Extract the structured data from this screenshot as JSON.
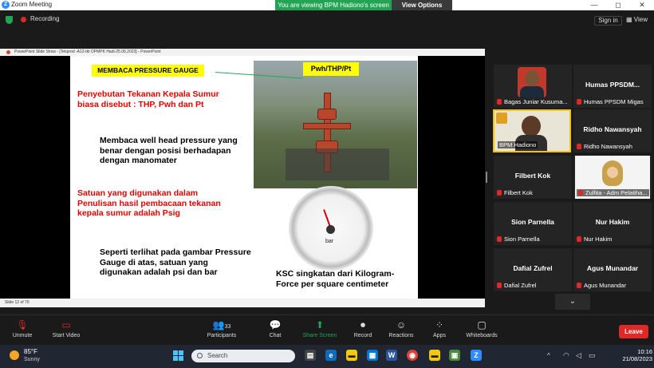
{
  "window": {
    "app_title": "Zoom Meeting",
    "viewing_banner": "You are viewing BPM Hadiono's screen",
    "view_options_label": "View Options",
    "controls": [
      "—",
      "◻",
      "✕"
    ]
  },
  "header": {
    "recording_label": "Recording",
    "sign_in_label": "Sign in",
    "view_label": "View"
  },
  "ppt": {
    "title_bar": "PowerPoint Slide Show - [Tekprod -A12-tkt OPMPK Hadi-25.06.2023] - PowerPoint",
    "status": "Slide 12 of 70"
  },
  "slide": {
    "title": "MEMBACA PRESSURE GAUGE",
    "photo_label": "Pwh/THP/Pt",
    "para1": "Penyebutan Tekanan Kepala Sumur biasa disebut : THP, Pwh dan Pt",
    "para2": "Membaca well head pressure yang benar dengan posisi berhadapan dengan manomater",
    "para3": "Satuan yang digunakan dalam Penulisan hasil pembacaan tekanan kepala sumur  adalah Psig",
    "para4": "Seperti terlihat pada gambar Pressure Gauge di atas, satuan yang digunakan adalah psi dan bar",
    "para5": "KSC singkatan dari Kilogram-Force per square centimeter",
    "gauge_unit": "bar"
  },
  "participants": [
    {
      "name": "Bagas Juniar Kusuma",
      "label": "Bagas Juniar Kusuma...",
      "video": true
    },
    {
      "name": "Humas  PPSDM...",
      "label": "Humas PPSDM Migas",
      "video": false
    },
    {
      "name": "BPM Hadiono",
      "label": "BPM Hadiono",
      "video": true,
      "active": true
    },
    {
      "name": "Ridho Nawansyah",
      "label": "Ridho Nawansyah",
      "video": false
    },
    {
      "name": "Filbert Kok",
      "label": "Filbert Kok",
      "video": false
    },
    {
      "name": "Zulfita - Adm Pelatiha...",
      "label": "Zulfita - Adm Pelatiha...",
      "video": true
    },
    {
      "name": "Sion Parnella",
      "label": "Sion Parnella",
      "video": false
    },
    {
      "name": "Nur Hakim",
      "label": "Nur Hakim",
      "video": false
    },
    {
      "name": "Dafial Zufrel",
      "label": "Dafial Zufrel",
      "video": false
    },
    {
      "name": "Agus Munandar",
      "label": "Agus Munandar",
      "video": false
    }
  ],
  "toolbar": {
    "unmute": "Unmute",
    "start_video": "Start Video",
    "participants": "Participants",
    "participants_count": "33",
    "chat": "Chat",
    "share_screen": "Share Screen",
    "record": "Record",
    "reactions": "Reactions",
    "apps": "Apps",
    "whiteboards": "Whiteboards",
    "leave": "Leave"
  },
  "taskbar": {
    "temperature": "85°F",
    "condition": "Sunny",
    "search_placeholder": "Search",
    "time": "10:16",
    "date": "21/08/2023"
  },
  "colors": {
    "zoom_green": "#23a455",
    "leave_red": "#e02828",
    "slide_yellow": "#ffff00",
    "slide_red": "#e20000",
    "active_speaker": "#f2c500"
  }
}
